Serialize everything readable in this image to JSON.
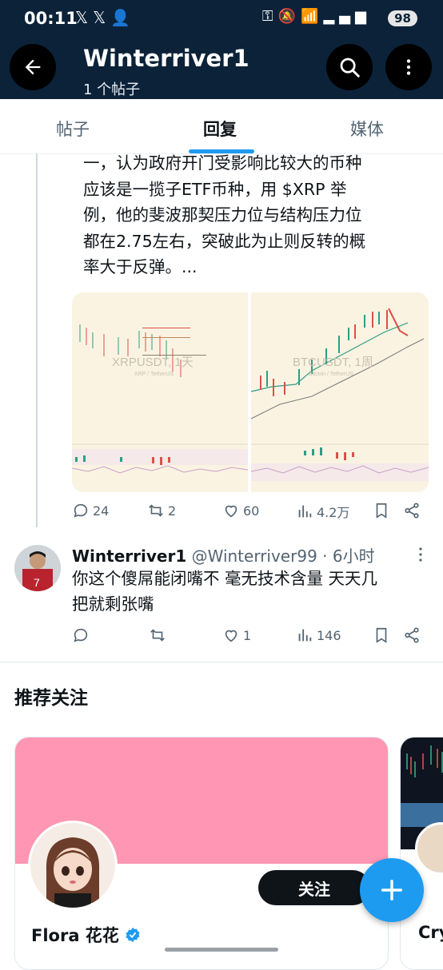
{
  "status_bar": {
    "time": "00:11",
    "left_icons": [
      "x-icon",
      "x-icon",
      "person-add-icon"
    ],
    "right_icons": [
      "key-icon",
      "mute-icon",
      "wifi-icon",
      "signal-icon",
      "signal-icon"
    ],
    "battery": "98"
  },
  "header": {
    "title": "Winterriver1",
    "subtitle": "1 个帖子"
  },
  "tabs": [
    {
      "label": "帖子",
      "active": false
    },
    {
      "label": "回复",
      "active": true
    },
    {
      "label": "媒体",
      "active": false
    }
  ],
  "post": {
    "text": "一，认为政府开门受影响比较大的币种\n应该是一揽子ETF币种，用 $XRP 举\n例，他的斐波那契压力位与结构压力位\n都在2.75左右，突破此为止则反转的概\n率大于反弹。...",
    "images": [
      {
        "watermark": "XRPUSDT, 1天",
        "sub": "XRP / TetherUS"
      },
      {
        "watermark": "BTCUSDT, 1周",
        "sub": "Bitcoin / TetherUS"
      }
    ],
    "stats": {
      "replies": "24",
      "reposts": "2",
      "likes": "60",
      "views": "4.2万"
    }
  },
  "reply": {
    "name": "Winterriver1",
    "handle": "@Winterriver99 · 6小时",
    "text": "你这个傻屌能闭嘴不 毫无技术含量 天天几\n把就剩张嘴",
    "stats": {
      "replies": "",
      "reposts": "",
      "likes": "1",
      "views": "146"
    }
  },
  "recommend": {
    "title": "推荐关注",
    "cards": [
      {
        "name": "Flora 花花",
        "follow_label": "关注",
        "verified": true,
        "banner_color": "#ff96b4"
      },
      {
        "name": "Cry"
      }
    ]
  },
  "colors": {
    "accent": "#1d9bf0",
    "header_bg": "#0b2239",
    "muted": "#536471"
  }
}
